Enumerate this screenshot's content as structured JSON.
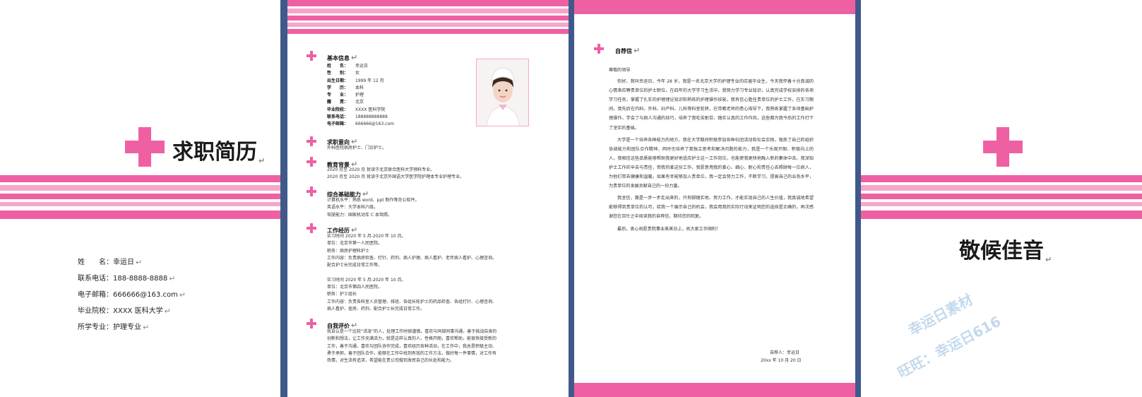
{
  "colors": {
    "accent": "#ef60a3",
    "accent_light": "#f6a6cb",
    "window_bg": "#3f5a8a"
  },
  "page1": {
    "title": "求职简历",
    "info": [
      {
        "label": "姓　　名：",
        "value": "幸运日"
      },
      {
        "label": "联系电话：",
        "value": "188-8888-8888"
      },
      {
        "label": "电子邮箱：",
        "value": "666666@163.com"
      },
      {
        "label": "毕业院校：",
        "value": "XXXX 医科大学"
      },
      {
        "label": "所学专业：",
        "value": "护理专业"
      }
    ]
  },
  "page2": {
    "basic": {
      "heading": "基本信息",
      "rows": [
        {
          "label": "姓　　名：",
          "value": "幸运日"
        },
        {
          "label": "性　　别：",
          "value": "女"
        },
        {
          "label": "出生日期：",
          "value": "1999 年 12 月"
        },
        {
          "label": "学　　历：",
          "value": "本科"
        },
        {
          "label": "专　　业：",
          "value": "护理"
        },
        {
          "label": "籍　　贯：",
          "value": "北京"
        },
        {
          "label": "毕业院校：",
          "value": "XXXX 医科学院"
        },
        {
          "label": "联系电话：",
          "value": "188888888888"
        },
        {
          "label": "电子邮箱：",
          "value": "666666@163.com"
        }
      ]
    },
    "intent": {
      "heading": "求职意向",
      "lines": [
        "外科医院病房护士、门诊护士。"
      ]
    },
    "education": {
      "heading": "教育背景",
      "lines": [
        "2020 月至 2020 月  就读于北京联合医科大学预科专业。",
        "2020 月至 2020 月  就读于北京外国语大学医学院护理本专业护理专业。"
      ]
    },
    "skills": {
      "heading": "综合基础能力",
      "lines": [
        "计算机水平：熟练 word、ppt 制作等办公软件。",
        "英语水平：大学本科六级。",
        "驾驶能力：国家机动车 C 本驾照。"
      ]
    },
    "work": {
      "heading": "工作经历",
      "lines": [
        "实习时间 2020 年 5 月-2020 年 10 月。",
        "单位：北京市第一人民医院。",
        "职务：病房护理科护士",
        "工作内容：负责病房检查、打针、药剂、病人护理、病人看护、老年病人看护、心理咨询。",
        "配合护士长完成日常工作等。",
        "",
        "实习时间 2020 年 5 月-2020 年 10 月。",
        "单位：北京市第四人民医院。",
        "职务：护士组长",
        "工作内容：负责各科室人员管理、排班、各组长轮护士的药品检查、各组打针、心理咨询、",
        "病人看护、查房、药剂、配合护士长完成日常工作。"
      ]
    },
    "self": {
      "heading": "自我评价",
      "lines": [
        "我自认是一个比较“活泼”的人，处理工作时很谨慎，喜欢与同部同事沟通，善于挑战自身的",
        "创新和想法，让工作充满活力，就是这样认真的人，性格开朗，喜欢帮助，能很快接受新的",
        "工作，善于沟通，喜欢与团队协作完成，喜欢经历各种活动，在工作中，我总是积极主动、",
        "勇于承担，善于团队合作，能够在工作中找到有效的工作方法，做好每一件事情，对工作有",
        "热情，对生活有追求，希望能在贵公司做到发挥自己的长处和能力。"
      ]
    }
  },
  "page3": {
    "heading": "自荐信",
    "salutation": "尊敬的领导",
    "paragraphs": [
      "你好，我叫幸运日，今年 28 岁，我是一名北京大学的护理专业的应届毕业生，今天我怀着十分真诚的心情来应聘贵单位的护士职位。在四年的大学学习生活中，我努力学习专业知识，认真完成学校安排的各项学习任务，掌握了扎实的护理理论知识和熟练的护理操作技能，我有信心胜任贵单位的护士工作，在实习期间，我先后在内科、外科、妇产科、儿科等科室轮转，在带教老师的悉心指导下，我熟练掌握了各项基础护理操作，学会了与病人沟通的技巧，培养了我吃苦耐劳、踏实认真的工作作风，这些都为我今后的工作打下了坚实的基础。",
      "大学是一个培养各种能力的地方，我在大学期间积极参加各种社团活动和社会实践，锻炼了自己的组织协调能力和团队合作精神，同时也培养了我独立思考和解决问题的能力，我是一个乐观开朗、积极向上的人，我相信这些品质能够帮助我更好地适应护士这一工作岗位，也能使我更快地融入新的集体中去。我深知护士工作的辛苦与责任，但我热爱这份工作，我愿意用我的爱心、细心、耐心和责任心去照顾每一位病人，为他们带去健康和温暖。如果有幸能够加入贵单位，我一定会努力工作，不断学习，提高自己的业务水平，为贵单位的发展贡献自己的一份力量。",
      "我坚信，路是一步一步走出来的，只有脚踏实地、努力工作，才能实现自己的人生价值，我真诚地希望能够得到贵单位的认可，给我一个展示自己的机会，我会用我的实际行动来证明您的选择是正确的，再次感谢您在百忙之中阅读我的自荐信，期待您的回复。",
      "最后，衷心祝愿贵院事业蒸蒸日上，祝大家工作顺利！"
    ],
    "signature": "自荐人：幸运日",
    "date": "20xx 年 10 月 20 日"
  },
  "page4": {
    "title": "敬候佳音"
  },
  "watermark": {
    "line1": "幸运日素材",
    "line2": "旺旺：幸运日616"
  }
}
